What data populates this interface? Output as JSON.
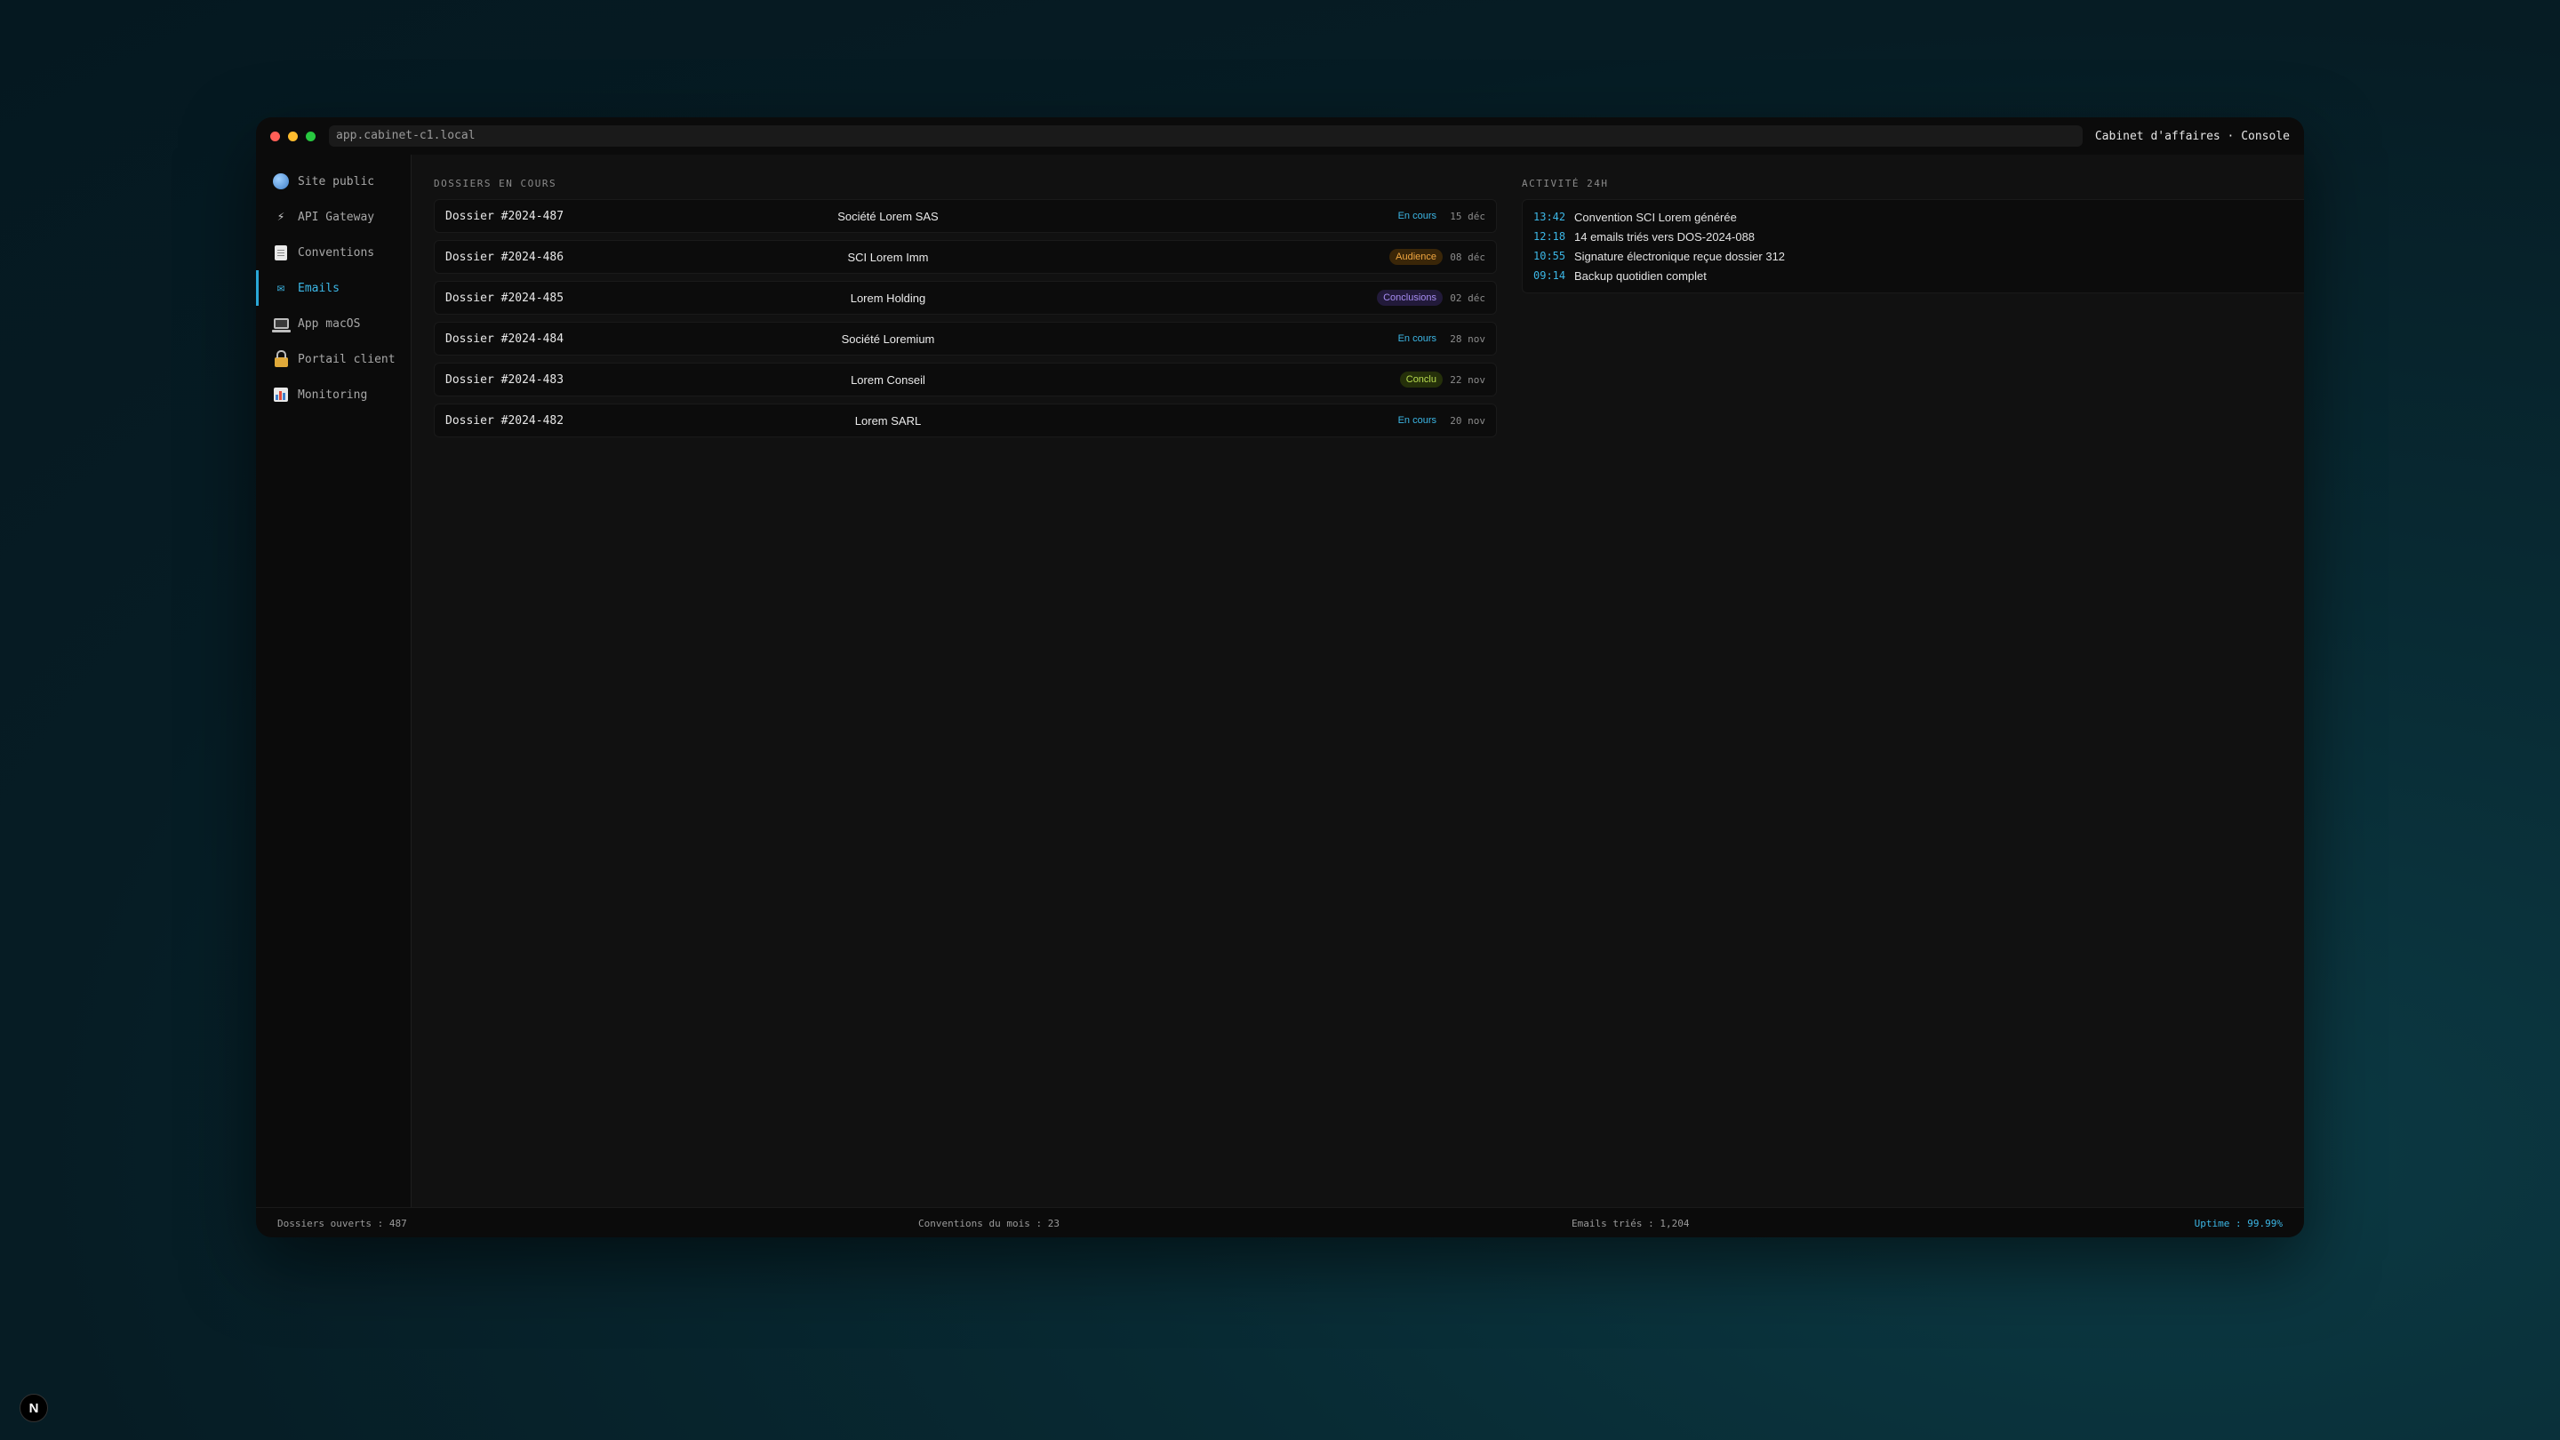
{
  "window": {
    "url": "app.cabinet-c1.local",
    "title": "Cabinet d'affaires · Console"
  },
  "sidebar": {
    "items": [
      {
        "label": "Site public",
        "icon": "globe-icon"
      },
      {
        "label": "API Gateway",
        "icon": "bolt-icon"
      },
      {
        "label": "Conventions",
        "icon": "document-icon"
      },
      {
        "label": "Emails",
        "icon": "mail-icon",
        "active": true
      },
      {
        "label": "App macOS",
        "icon": "laptop-icon"
      },
      {
        "label": "Portail client",
        "icon": "lock-icon"
      },
      {
        "label": "Monitoring",
        "icon": "bar-chart-icon"
      }
    ]
  },
  "dossiers": {
    "title": "DOSSIERS EN COURS",
    "rows": [
      {
        "id": "Dossier #2024-487",
        "client": "Société Lorem SAS",
        "status": "En cours",
        "status_color": "#3cb7e6",
        "date": "15 déc"
      },
      {
        "id": "Dossier #2024-486",
        "client": "SCI Lorem Imm",
        "status": "Audience",
        "status_color": "#f0a640",
        "date": "08 déc"
      },
      {
        "id": "Dossier #2024-485",
        "client": "Lorem Holding",
        "status": "Conclusions",
        "status_color": "#a68cf0",
        "date": "02 déc"
      },
      {
        "id": "Dossier #2024-484",
        "client": "Société Loremium",
        "status": "En cours",
        "status_color": "#3cb7e6",
        "date": "28 nov"
      },
      {
        "id": "Dossier #2024-483",
        "client": "Lorem Conseil",
        "status": "Conclu",
        "status_color": "#b8dc50",
        "date": "22 nov"
      },
      {
        "id": "Dossier #2024-482",
        "client": "Lorem SARL",
        "status": "En cours",
        "status_color": "#3cb7e6",
        "date": "20 nov"
      }
    ]
  },
  "activity": {
    "title": "ACTIVITÉ 24H",
    "entries": [
      {
        "time": "13:42",
        "text": "Convention SCI Lorem générée"
      },
      {
        "time": "12:18",
        "text": "14 emails triés vers DOS-2024-088"
      },
      {
        "time": "10:55",
        "text": "Signature électronique reçue dossier 312"
      },
      {
        "time": "09:14",
        "text": "Backup quotidien complet"
      }
    ]
  },
  "statusbar": {
    "dossiers": "Dossiers ouverts : 487",
    "conventions": "Conventions du mois : 23",
    "emails": "Emails triés : 1,204",
    "uptime": "Uptime : 99.99%"
  },
  "badge": {
    "label": "N"
  },
  "colors": {
    "accent": "#2aa7d6",
    "background": "#111111"
  }
}
